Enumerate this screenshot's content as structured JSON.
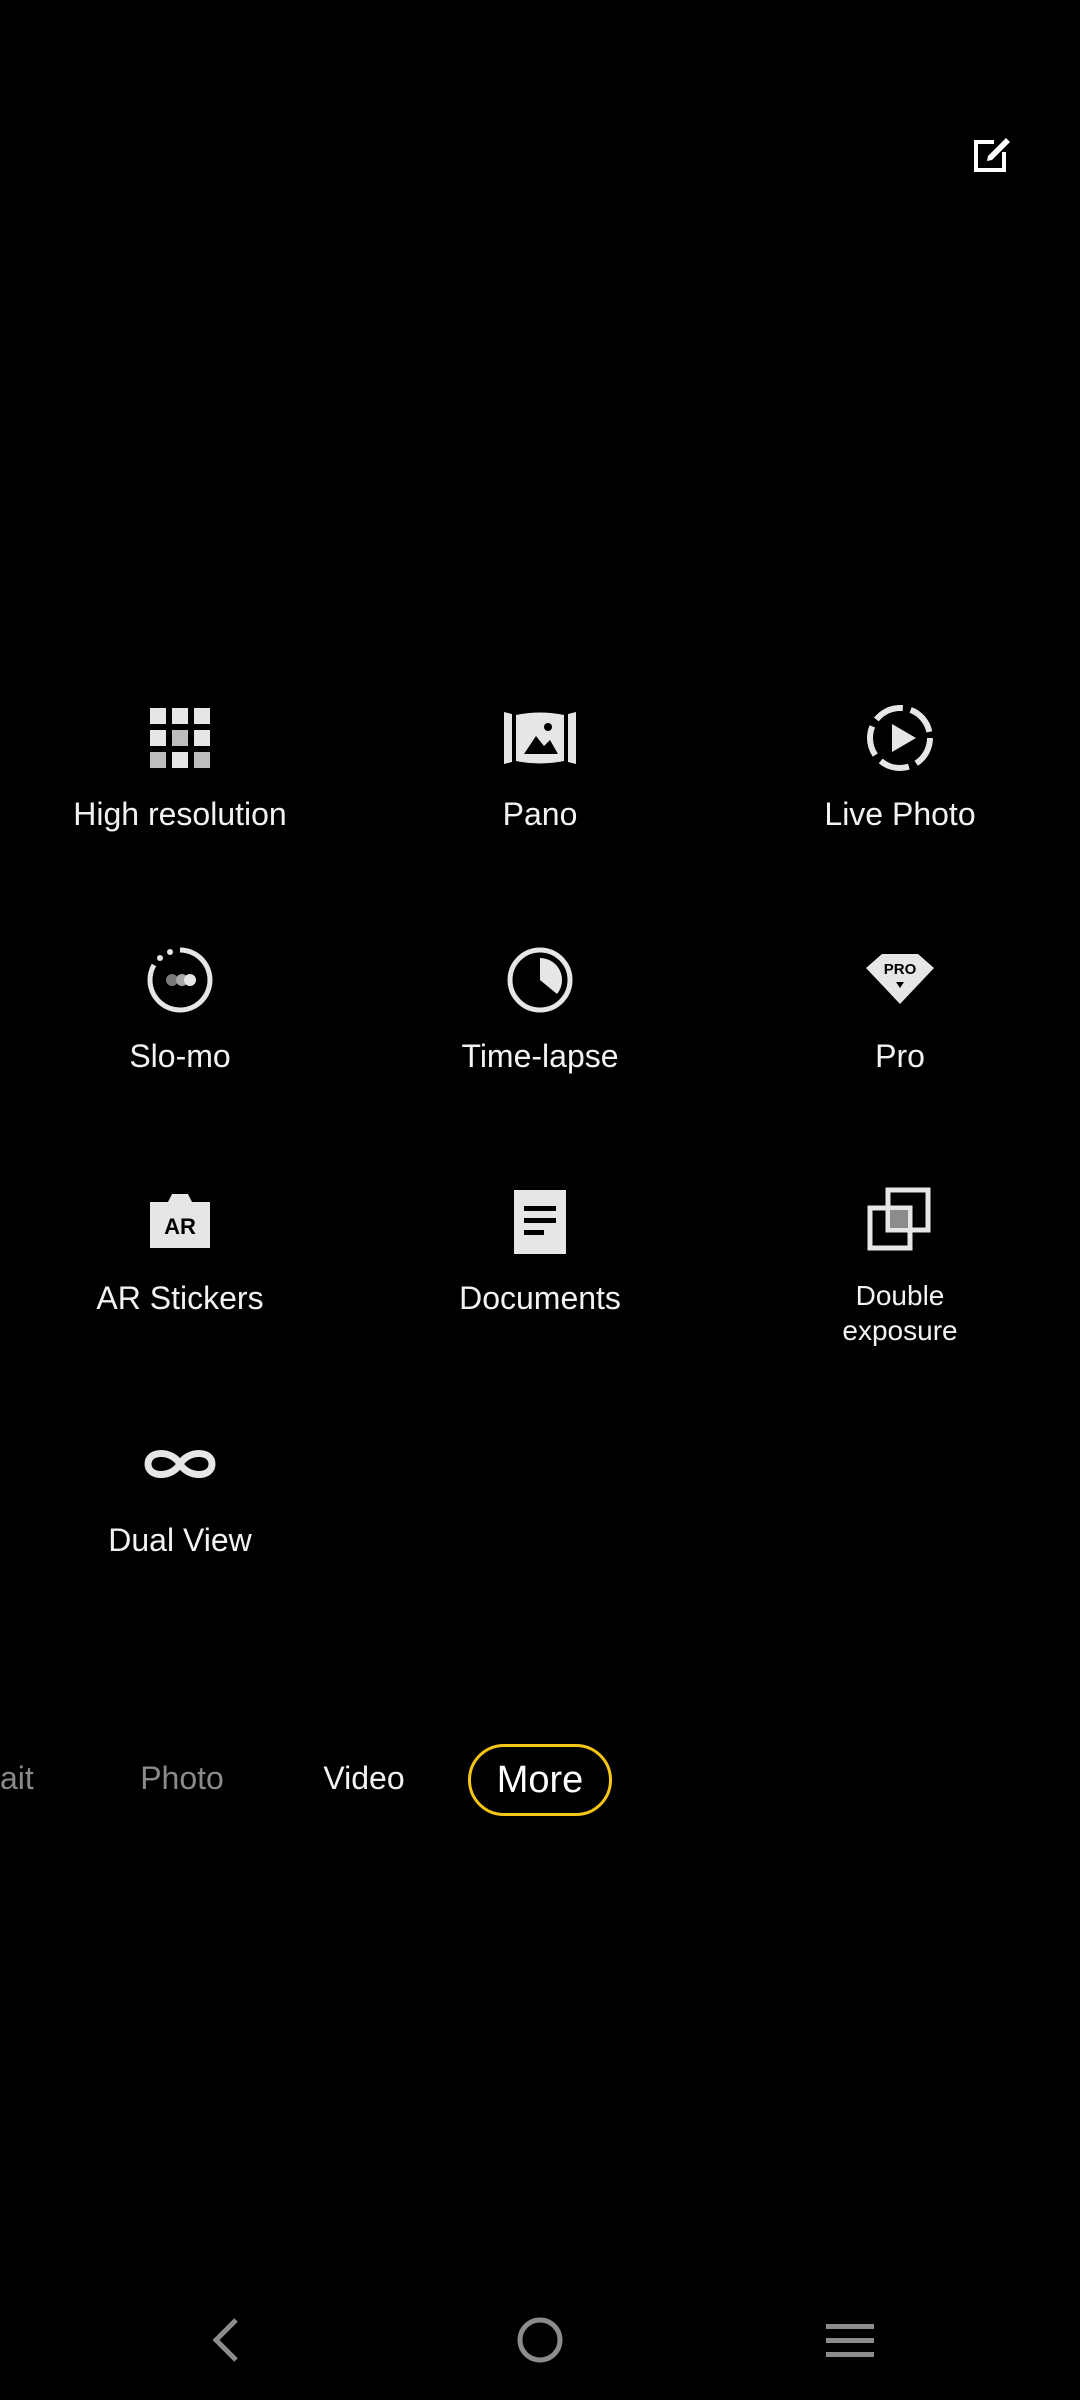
{
  "toolbar": {
    "edit_icon": "edit-icon"
  },
  "modes": [
    {
      "label": "High resolution",
      "icon": "high-resolution-icon"
    },
    {
      "label": "Pano",
      "icon": "pano-icon"
    },
    {
      "label": "Live Photo",
      "icon": "live-photo-icon"
    },
    {
      "label": "Slo-mo",
      "icon": "slo-mo-icon"
    },
    {
      "label": "Time-lapse",
      "icon": "time-lapse-icon"
    },
    {
      "label": "Pro",
      "icon": "pro-icon",
      "badge": "PRO"
    },
    {
      "label": "AR Stickers",
      "icon": "ar-stickers-icon",
      "badge": "AR"
    },
    {
      "label": "Documents",
      "icon": "documents-icon"
    },
    {
      "label": "Double\nexposure",
      "icon": "double-exposure-icon"
    },
    {
      "label": "Dual View",
      "icon": "dual-view-icon"
    }
  ],
  "mode_bar": {
    "tabs": [
      {
        "label": "ait"
      },
      {
        "label": "Photo"
      },
      {
        "label": "Video"
      },
      {
        "label": "More"
      }
    ],
    "active_color": "#f5c518"
  },
  "nav": {
    "back_icon": "back-icon",
    "home_icon": "home-icon",
    "menu_icon": "menu-icon"
  }
}
